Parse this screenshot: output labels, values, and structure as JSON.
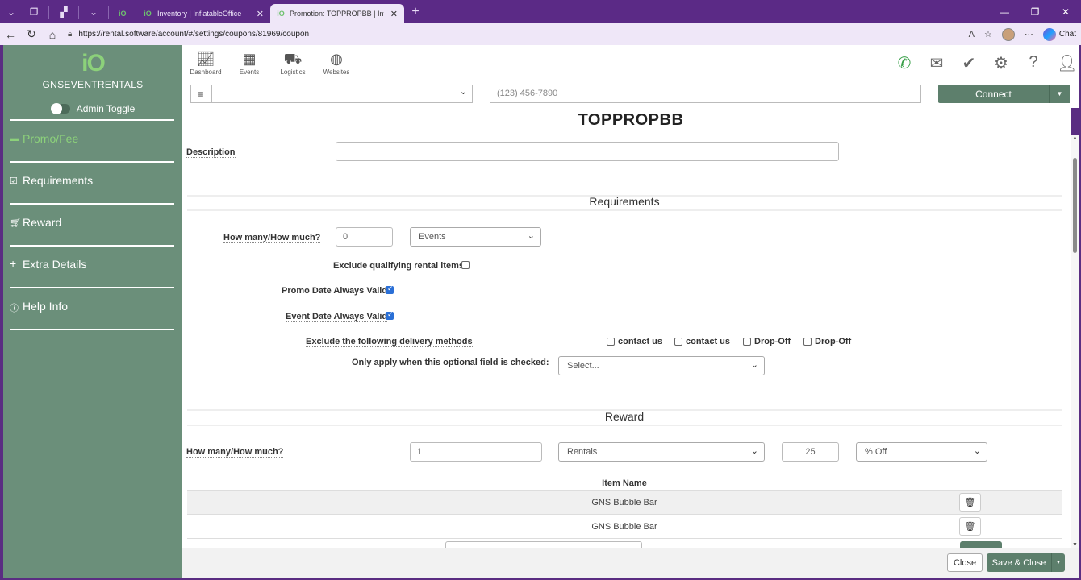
{
  "browser": {
    "tabs": [
      {
        "label": "",
        "icon": "io"
      },
      {
        "label": "Inventory | InflatableOffice",
        "icon": "io"
      },
      {
        "label": "Promotion: TOPPROPBB | Inflatabl",
        "icon": "io",
        "active": true
      }
    ],
    "url": "https://rental.software/account/#/settings/coupons/81969/coupon",
    "chat_label": "Chat"
  },
  "sidebar": {
    "logo_mark": "iO",
    "company": "GNSEVENTRENTALS",
    "admin_toggle": "Admin Toggle",
    "items": [
      {
        "label": "Promo/Fee",
        "icon": "money-icon",
        "active": true
      },
      {
        "label": "Requirements",
        "icon": "check-square-icon"
      },
      {
        "label": "Reward",
        "icon": "cart-icon"
      },
      {
        "label": "Extra Details",
        "icon": "plus-icon"
      },
      {
        "label": "Help Info",
        "icon": "info-icon"
      }
    ]
  },
  "topnav": {
    "items": [
      {
        "label": "Dashboard",
        "icon": "chart-icon"
      },
      {
        "label": "Events",
        "icon": "calendar-icon"
      },
      {
        "label": "Logistics",
        "icon": "truck-icon"
      },
      {
        "label": "Websites",
        "icon": "globe-icon"
      }
    ]
  },
  "toolbar": {
    "phone_placeholder": "(123) 456-7890",
    "connect_label": "Connect"
  },
  "form": {
    "title": "TOPPROPBB",
    "description_label": "Description",
    "description_value": "",
    "requirements_heading": "Requirements",
    "req_how_many_label": "How many/How much?",
    "req_how_many_value": "0",
    "req_unit": "Events",
    "exclude_items_label": "Exclude qualifying rental items",
    "exclude_items_checked": false,
    "promo_date_label": "Promo Date Always Valid",
    "promo_date_checked": true,
    "event_date_label": "Event Date Always Valid",
    "event_date_checked": true,
    "exclude_delivery_label": "Exclude the following delivery methods",
    "delivery_methods": [
      {
        "label": "contact us",
        "checked": false
      },
      {
        "label": "contact us",
        "checked": false
      },
      {
        "label": "Drop-Off",
        "checked": false
      },
      {
        "label": "Drop-Off",
        "checked": false
      }
    ],
    "optional_field_label": "Only apply when this optional field is checked:",
    "optional_field_value": "Select...",
    "reward_heading": "Reward",
    "reward_how_many_label": "How many/How much?",
    "reward_qty": "1",
    "reward_unit": "Rentals",
    "reward_amount": "25",
    "reward_type": "% Off",
    "item_name_header": "Item Name",
    "items": [
      "GNS Bubble Bar",
      "GNS Bubble Bar"
    ]
  },
  "footer": {
    "close_label": "Close",
    "save_close_label": "Save & Close"
  }
}
